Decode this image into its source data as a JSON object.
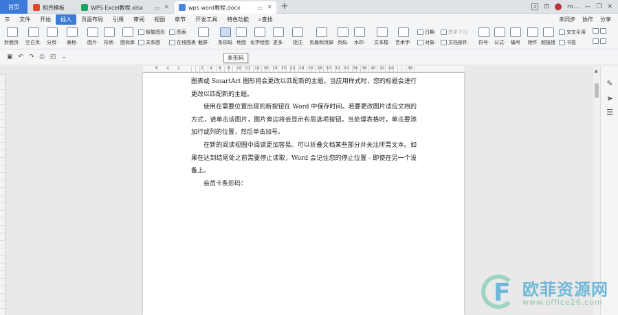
{
  "tabs": {
    "home": "首页",
    "items": [
      {
        "label": "稻壳模板"
      },
      {
        "label": "WPS Excel教程.xlsx"
      },
      {
        "label": "wps word教程.docx"
      }
    ],
    "new_tab": "+"
  },
  "titlebar_right": {
    "badge": "2",
    "user": "m..."
  },
  "menu": {
    "items": [
      "文件",
      "开始",
      "插入",
      "页面布局",
      "引用",
      "审阅",
      "视图",
      "章节",
      "开发工具",
      "特色功能",
      "查找"
    ],
    "active": "插入",
    "right": [
      "未同步",
      "协作",
      "分享"
    ]
  },
  "ribbon": {
    "buttons": [
      {
        "label": "封面页·"
      },
      {
        "label": "空白页·"
      },
      {
        "label": "分页·"
      },
      {
        "label": "表格·"
      },
      {
        "label": "图片·"
      },
      {
        "label": "形状·"
      },
      {
        "label": "图标库"
      },
      {
        "label": "截屏·"
      },
      {
        "label": "条形码"
      },
      {
        "label": "地图"
      },
      {
        "label": "化学绘图"
      },
      {
        "label": "更多·"
      },
      {
        "label": "批注"
      },
      {
        "label": "页眉和页脚"
      },
      {
        "label": "页码·"
      },
      {
        "label": "水印·"
      },
      {
        "label": "文本框·"
      },
      {
        "label": "艺术字·"
      },
      {
        "label": "符号·"
      },
      {
        "label": "公式·"
      },
      {
        "label": "编号"
      },
      {
        "label": "附件"
      },
      {
        "label": "超链接"
      }
    ],
    "small": {
      "smart_graphic": "智能图形",
      "chart": "图表",
      "relation": "关系图",
      "online_chart": "在线图表",
      "date": "日期",
      "first_letter": "首字下沉",
      "object": "对象·",
      "doc_parts": "文档部件·",
      "cross_ref": "交叉引用",
      "bookmark": "书签"
    }
  },
  "tooltip": "条形码",
  "ruler": {
    "numbers": [
      "6",
      "4",
      "2",
      "2",
      "4",
      "6",
      "8",
      "10",
      "12",
      "14",
      "16",
      "18",
      "20",
      "22",
      "24",
      "26",
      "28",
      "30",
      "32",
      "34",
      "36",
      "38",
      "40",
      "42",
      "44",
      "46"
    ]
  },
  "document": {
    "paragraphs": [
      {
        "text": "图表或 SmartArt 图形将会更改以匹配新的主题。当应用样式时，您的标题会进行更改以匹配新的主题。",
        "indent": false
      },
      {
        "text": "使用在需要位置出现的新按钮在 Word 中保存时间。若要更改图片适应文档的方式，请单击该图片，图片旁边将会显示布局选项按钮。当处理表格时，单击要添加行或列的位置，然后单击加号。",
        "indent": true
      },
      {
        "text": "在新的阅读视图中阅读更加容易。可以折叠文档某些部分并关注所需文本。如果在达到结尾处之前需要停止读取，Word 会记住您的停止位置 - 即使在另一个设备上。",
        "indent": true
      },
      {
        "text": "会员卡条形码：",
        "indent": true
      }
    ]
  },
  "watermark": {
    "name": "欧菲资源网",
    "url": "www.office26.com"
  }
}
